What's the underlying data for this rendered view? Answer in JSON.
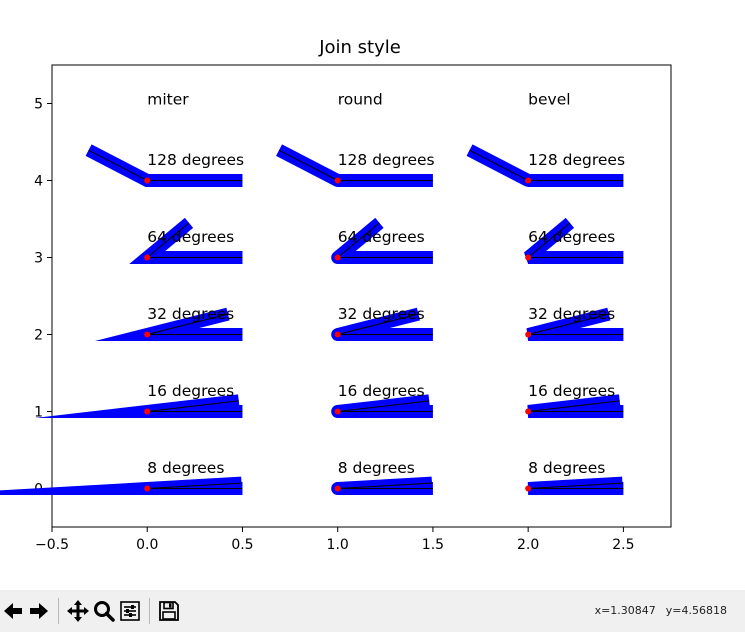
{
  "window": {
    "toolbar": {
      "buttons": [
        {
          "name": "back-button",
          "icon": "left-arrow-icon"
        },
        {
          "name": "forward-button",
          "icon": "right-arrow-icon"
        },
        {
          "name": "pan-button",
          "icon": "move-icon"
        },
        {
          "name": "zoom-button",
          "icon": "magnifier-icon"
        },
        {
          "name": "configure-subplots-button",
          "icon": "sliders-icon"
        },
        {
          "name": "save-button",
          "icon": "floppy-disk-icon"
        }
      ],
      "x_readout": "x=1.30847",
      "y_readout": "y=4.56818"
    }
  },
  "chart_data": {
    "type": "line",
    "title": "Join style",
    "xlabel": "",
    "ylabel": "",
    "xlim": [
      -0.5,
      2.75
    ],
    "ylim": [
      -0.5,
      5.5
    ],
    "xticks": [
      -0.5,
      0.0,
      0.5,
      1.0,
      1.5,
      2.0,
      2.5
    ],
    "xtick_labels": [
      "−0.5",
      "0.0",
      "0.5",
      "1.0",
      "1.5",
      "2.0",
      "2.5"
    ],
    "yticks": [
      0,
      1,
      2,
      3,
      4,
      5
    ],
    "ytick_labels": [
      "0",
      "1",
      "2",
      "3",
      "4",
      "5"
    ],
    "grid": false,
    "column_labels": [
      {
        "text": "miter",
        "x": 0,
        "y": 5
      },
      {
        "text": "round",
        "x": 1,
        "y": 5
      },
      {
        "text": "bevel",
        "x": 2,
        "y": 5
      }
    ],
    "join_styles": [
      "miter",
      "round",
      "bevel"
    ],
    "angles_deg": [
      8,
      16,
      32,
      64,
      128
    ],
    "row_labels": [
      "8 degrees",
      "16 degrees",
      "32 degrees",
      "64 degrees",
      "128 degrees"
    ],
    "segment_length": 0.5,
    "thick_line_color": "#0000ff",
    "thin_line_color": "#000000",
    "vertex_marker_color": "#ff0000"
  }
}
